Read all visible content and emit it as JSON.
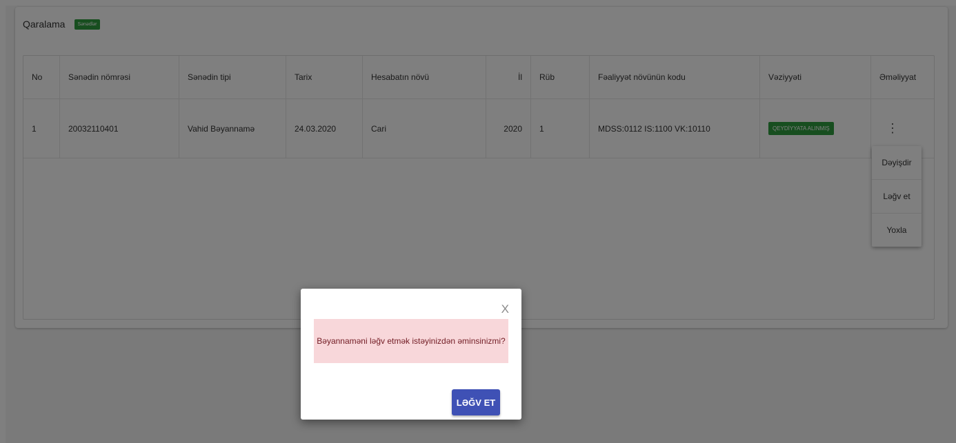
{
  "card": {
    "title": "Qaralama",
    "badge": "Sənədlər"
  },
  "table": {
    "headers": [
      "No",
      "Sənədin nömrəsi",
      "Sənədin tipi",
      "Tarix",
      "Hesabatın növü",
      "İl",
      "Rüb",
      "Fəaliyyət növünün kodu",
      "Vəziyyəti",
      "Əməliyyat"
    ],
    "rows": [
      {
        "no": "1",
        "doc_number": "20032110401",
        "doc_type": "Vahid Bəyannamə",
        "date": "24.03.2020",
        "report_type": "Cari",
        "year": "2020",
        "quarter": "1",
        "activity_code": "MDSS:0112 IS:1100 VK:10110",
        "status": "QEYDİYYATA ALINMIŞ",
        "action_icon": "kebab-menu-icon"
      }
    ]
  },
  "action_menu": {
    "items": [
      "Dəyişdir",
      "Ləğv et",
      "Yoxla"
    ]
  },
  "modal": {
    "close_label": "X",
    "message": "Bəyannaməni ləğv etmək istəyinizdən əminsinizmi?",
    "confirm_label": "LƏĞV ET"
  },
  "colors": {
    "status_green": "#2e9c3f",
    "primary_button": "#3f51b5",
    "alert_background": "#f8d7da"
  }
}
